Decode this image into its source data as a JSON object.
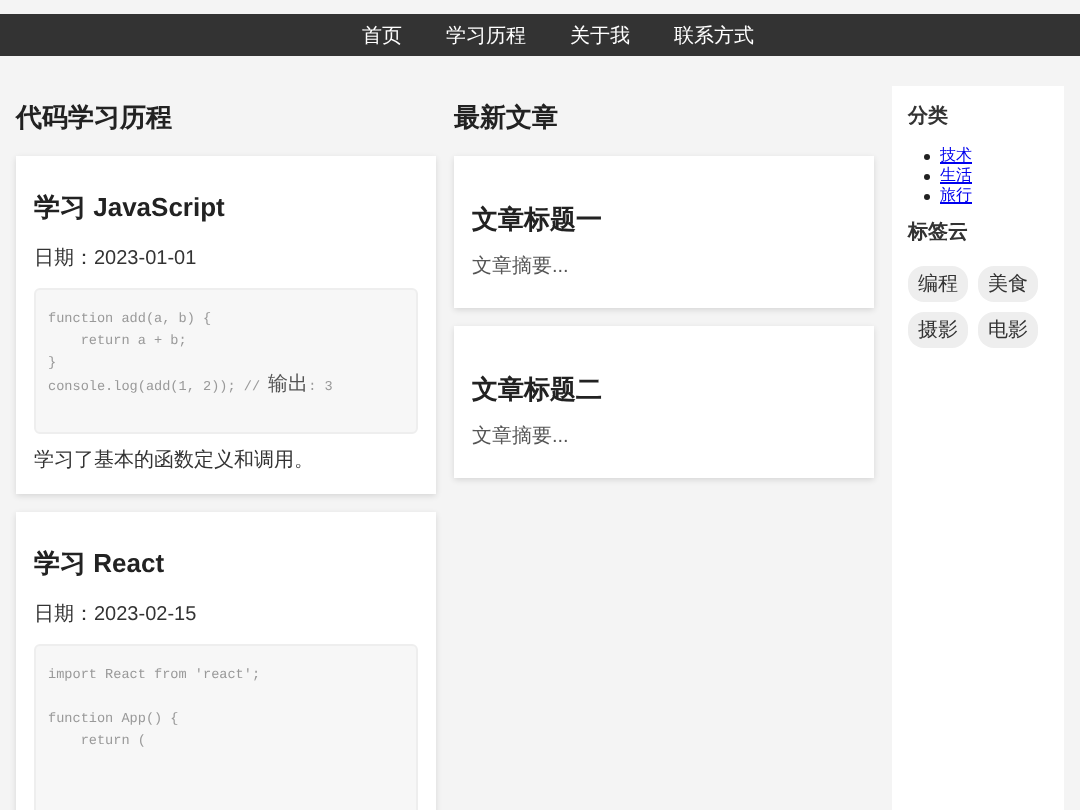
{
  "nav": {
    "items": [
      {
        "label": "首页"
      },
      {
        "label": "学习历程"
      },
      {
        "label": "关于我"
      },
      {
        "label": "联系方式"
      }
    ]
  },
  "learning": {
    "heading": "代码学习历程",
    "entries": [
      {
        "title": "学习 JavaScript",
        "date": "日期：2023-01-01",
        "code": "function add(a, b) {\n    return a + b;\n}\nconsole.log(add(1, 2)); // 输出: 3",
        "summary": "学习了基本的函数定义和调用。"
      },
      {
        "title": "学习 React",
        "date": "日期：2023-02-15",
        "code": "import React from 'react';\n\nfunction App() {\n    return (\n\n\n\n\n"
      }
    ]
  },
  "articles": {
    "heading": "最新文章",
    "items": [
      {
        "title": "文章标题一",
        "excerpt": "文章摘要..."
      },
      {
        "title": "文章标题二",
        "excerpt": "文章摘要..."
      }
    ]
  },
  "sidebar": {
    "categories_heading": "分类",
    "categories": [
      {
        "label": "技术"
      },
      {
        "label": "生活"
      },
      {
        "label": "旅行"
      }
    ],
    "tags_heading": "标签云",
    "tags": [
      {
        "label": "编程"
      },
      {
        "label": "美食"
      },
      {
        "label": "摄影"
      },
      {
        "label": "电影"
      }
    ]
  }
}
